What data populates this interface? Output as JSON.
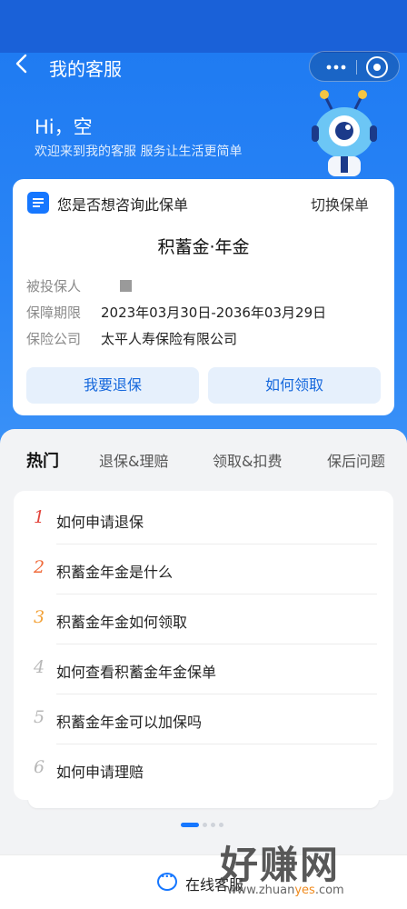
{
  "nav": {
    "title": "我的客服",
    "back_icon": "chevron-left-icon",
    "more_icon": "more-dots-icon",
    "close_icon": "target-circle-icon"
  },
  "hero": {
    "greeting": "Hi，空",
    "subtitle": "欢迎来到我的客服 服务让生活更简单",
    "mascot_icon": "robot-mascot-icon"
  },
  "policy": {
    "question": "您是否想咨询此保单",
    "switch_label": "切换保单",
    "name": "积蓄金·年金",
    "insured_label": "被投保人",
    "period_label": "保障期限",
    "period_value": "2023年03月30日-2036年03月29日",
    "company_label": "保险公司",
    "company_value": "太平人寿保险有限公司",
    "buttons": [
      "我要退保",
      "如何领取"
    ]
  },
  "tabs": [
    {
      "label": "热门",
      "active": true
    },
    {
      "label": "退保&理赔",
      "active": false
    },
    {
      "label": "领取&扣费",
      "active": false
    },
    {
      "label": "保后问题",
      "active": false
    }
  ],
  "faq": [
    {
      "num": "1",
      "text": "如何申请退保",
      "color": "#e2453c"
    },
    {
      "num": "2",
      "text": "积蓄金年金是什么",
      "color": "#f06a3a"
    },
    {
      "num": "3",
      "text": "积蓄金年金如何领取",
      "color": "#f3a33a"
    },
    {
      "num": "4",
      "text": "如何查看积蓄金年金保单",
      "color": "#b8b8b8"
    },
    {
      "num": "5",
      "text": "积蓄金年金可以加保吗",
      "color": "#b8b8b8"
    },
    {
      "num": "6",
      "text": "如何申请理赔",
      "color": "#b8b8b8"
    }
  ],
  "pager": {
    "total": 4,
    "active_index": 0
  },
  "bottom": {
    "chat_label": "在线客服",
    "chat_icon": "chat-bubble-icon"
  },
  "watermark": {
    "big": "好赚网",
    "small_prefix": "www.zhuan",
    "small_highlight": "yes",
    "small_suffix": ".com"
  },
  "colors": {
    "brand": "#1677ff",
    "status_bar": "#1a61d8"
  }
}
